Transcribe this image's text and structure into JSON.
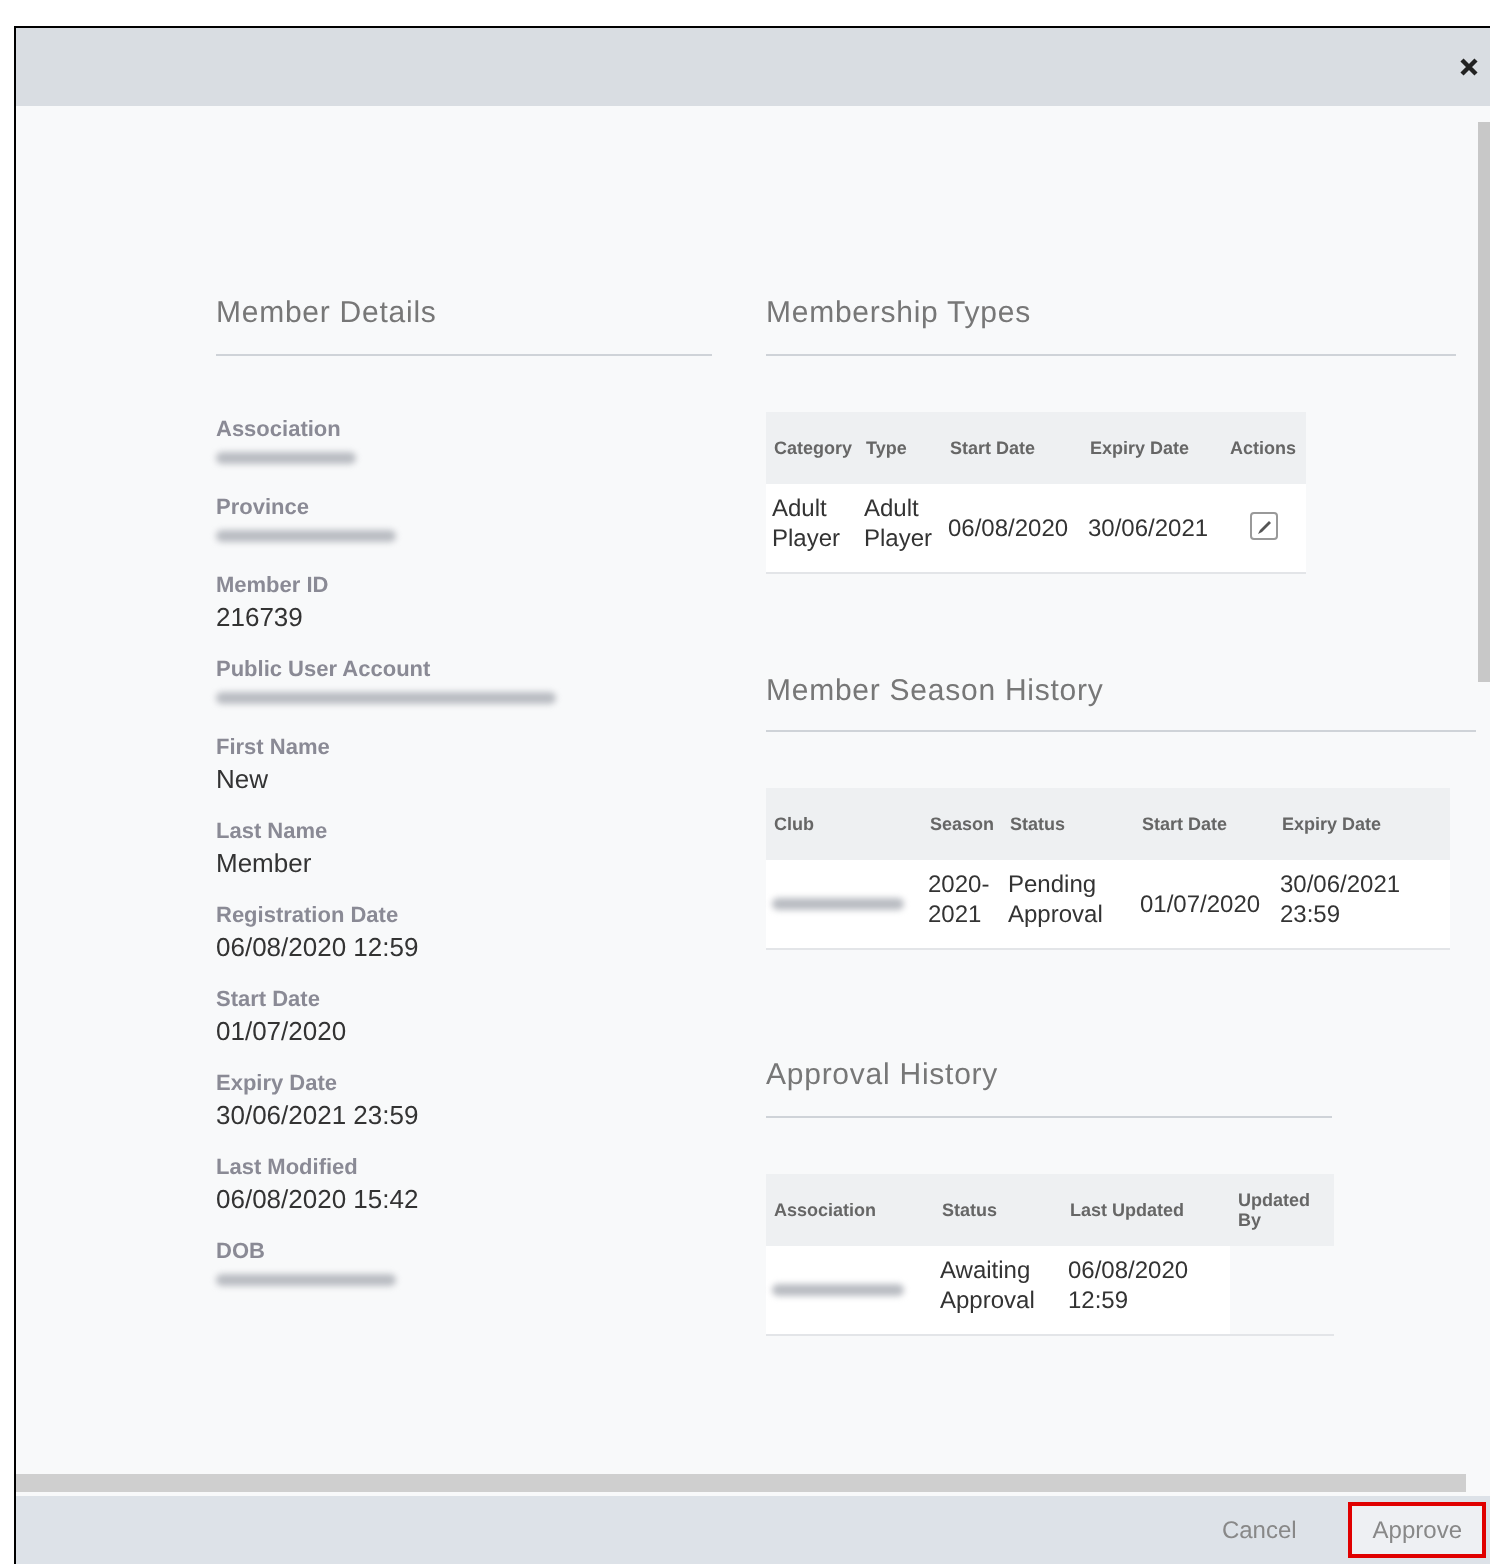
{
  "member_details": {
    "heading": "Member Details",
    "fields": [
      {
        "label": "Association",
        "redacted": true
      },
      {
        "label": "Province",
        "redacted": true
      },
      {
        "label": "Member ID",
        "value": "216739",
        "redacted": false
      },
      {
        "label": "Public User Account",
        "redacted": true
      },
      {
        "label": "First Name",
        "value": "New",
        "redacted": false
      },
      {
        "label": "Last Name",
        "value": "Member",
        "redacted": false
      },
      {
        "label": "Registration Date",
        "value": "06/08/2020 12:59",
        "redacted": false
      },
      {
        "label": "Start Date",
        "value": "01/07/2020",
        "redacted": false
      },
      {
        "label": "Expiry Date",
        "value": "30/06/2021 23:59",
        "redacted": false
      },
      {
        "label": "Last Modified",
        "value": "06/08/2020 15:42",
        "redacted": false
      },
      {
        "label": "DOB",
        "redacted": true
      }
    ]
  },
  "membership_types": {
    "heading": "Membership Types",
    "columns": [
      "Category",
      "Type",
      "Start Date",
      "Expiry Date",
      "Actions"
    ],
    "rows": [
      {
        "cells": [
          {
            "text": "Adult Player",
            "redacted": false
          },
          {
            "text": "Adult Player",
            "redacted": false
          },
          {
            "text": "06/08/2020",
            "redacted": false
          },
          {
            "text": "30/06/2021",
            "redacted": false
          }
        ],
        "editable": true
      }
    ]
  },
  "season_history": {
    "heading": "Member Season History",
    "columns": [
      "Club",
      "Season",
      "Status",
      "Start Date",
      "Expiry Date"
    ],
    "rows": [
      {
        "cells": [
          {
            "redacted": true
          },
          {
            "text": "2020-2021",
            "redacted": false
          },
          {
            "text": "Pending Approval",
            "redacted": false
          },
          {
            "text": "01/07/2020",
            "redacted": false
          },
          {
            "text": "30/06/2021 23:59",
            "redacted": false
          }
        ]
      }
    ]
  },
  "approval_history": {
    "heading": "Approval History",
    "columns": [
      "Association",
      "Status",
      "Last Updated",
      "Updated By"
    ],
    "rows": [
      {
        "cells": [
          {
            "redacted": true
          },
          {
            "text": "Awaiting Approval",
            "redacted": false
          },
          {
            "text": "06/08/2020 12:59",
            "redacted": false
          }
        ]
      }
    ]
  },
  "footer": {
    "buttons": [
      {
        "label": "Cancel",
        "selected": false
      },
      {
        "label": "Approve",
        "selected": true
      }
    ]
  }
}
